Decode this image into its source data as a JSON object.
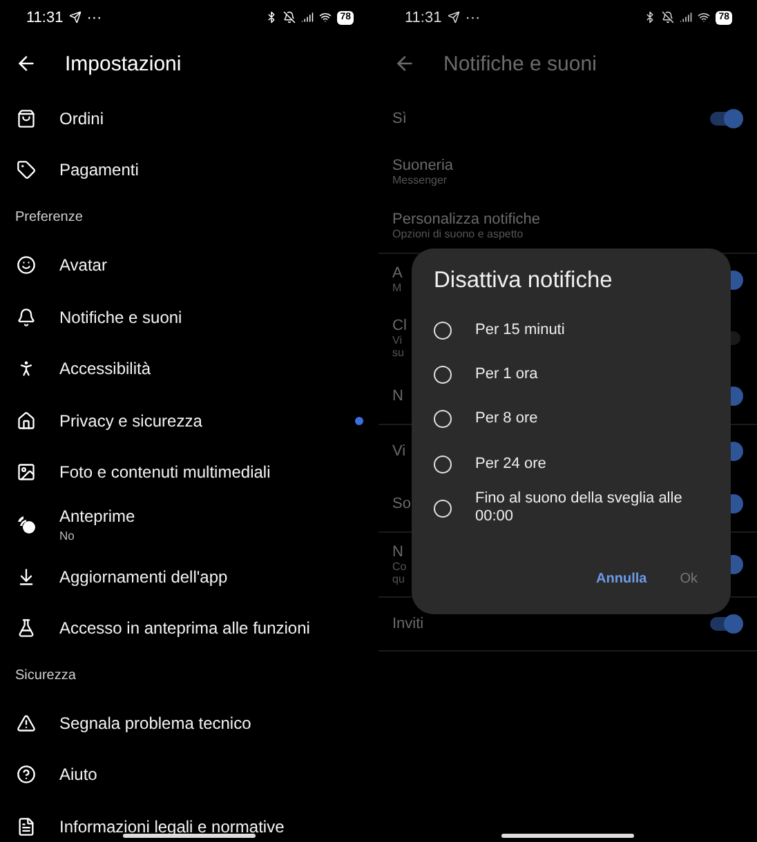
{
  "screens": [
    {
      "status_bar": {
        "time": "11:31",
        "more": "···",
        "battery": "78"
      },
      "title": "Impostazioni",
      "sections": [
        {
          "items": [
            {
              "label": "Ordini",
              "unread": false
            },
            {
              "label": "Pagamenti",
              "unread": false
            }
          ]
        },
        {
          "heading": "Preferenze",
          "items": [
            {
              "label": "Avatar",
              "unread": false
            },
            {
              "label": "Notifiche e suoni",
              "unread": false
            },
            {
              "label": "Accessibilità",
              "unread": false
            },
            {
              "label": "Privacy e sicurezza",
              "unread": true
            },
            {
              "label": "Foto e contenuti multimediali",
              "unread": false
            },
            {
              "label": "Anteprime",
              "subtitle": "No",
              "unread": false
            },
            {
              "label": "Aggiornamenti dell'app",
              "unread": false
            },
            {
              "label": "Accesso in anteprima alle funzioni",
              "unread": false
            }
          ]
        },
        {
          "heading": "Sicurezza",
          "items": [
            {
              "label": "Segnala problema tecnico",
              "unread": false
            },
            {
              "label": "Aiuto",
              "unread": false
            },
            {
              "label": "Informazioni legali e normative",
              "unread": false
            }
          ]
        }
      ]
    },
    {
      "status_bar": {
        "time": "11:31",
        "more": "···",
        "battery": "78"
      },
      "title": "Notifiche e suoni",
      "groups": [
        [
          {
            "kind": "toggle",
            "title": "Sì",
            "on": true
          },
          {
            "kind": "link",
            "title": "Suoneria",
            "subtitle_lines": [
              "Messenger"
            ]
          },
          {
            "kind": "link",
            "title": "Personalizza notifiche",
            "subtitle_lines": [
              "Opzioni di suono e aspetto"
            ]
          }
        ],
        [
          {
            "kind": "toggle",
            "title": "A",
            "subtitle_lines": [
              "M"
            ],
            "on": true
          },
          {
            "kind": "toggle",
            "title": "Cl",
            "subtitle_lines": [
              "Vi",
              "su"
            ],
            "on": false
          },
          {
            "kind": "toggle",
            "title": "N",
            "on": true
          }
        ],
        [
          {
            "kind": "toggle",
            "title": "Vi",
            "on": true
          },
          {
            "kind": "toggle",
            "title": "So",
            "on": true
          }
        ],
        [
          {
            "kind": "toggle",
            "title": "N",
            "subtitle_lines": [
              "Co",
              "qu"
            ],
            "on": true
          }
        ],
        [
          {
            "kind": "toggle",
            "title": "Inviti",
            "on": true
          }
        ]
      ],
      "dialog": {
        "title": "Disattiva notifiche",
        "options": [
          {
            "label": "Per 15 minuti",
            "selected": false
          },
          {
            "label": "Per 1 ora",
            "selected": false
          },
          {
            "label": "Per 8 ore",
            "selected": false
          },
          {
            "label": "Per 24 ore",
            "selected": false
          },
          {
            "label": "Fino al suono della sveglia alle 00:00",
            "selected": false
          }
        ],
        "buttons": [
          {
            "label": "Annulla",
            "disabled": false
          },
          {
            "label": "Ok",
            "disabled": true
          }
        ]
      }
    }
  ]
}
